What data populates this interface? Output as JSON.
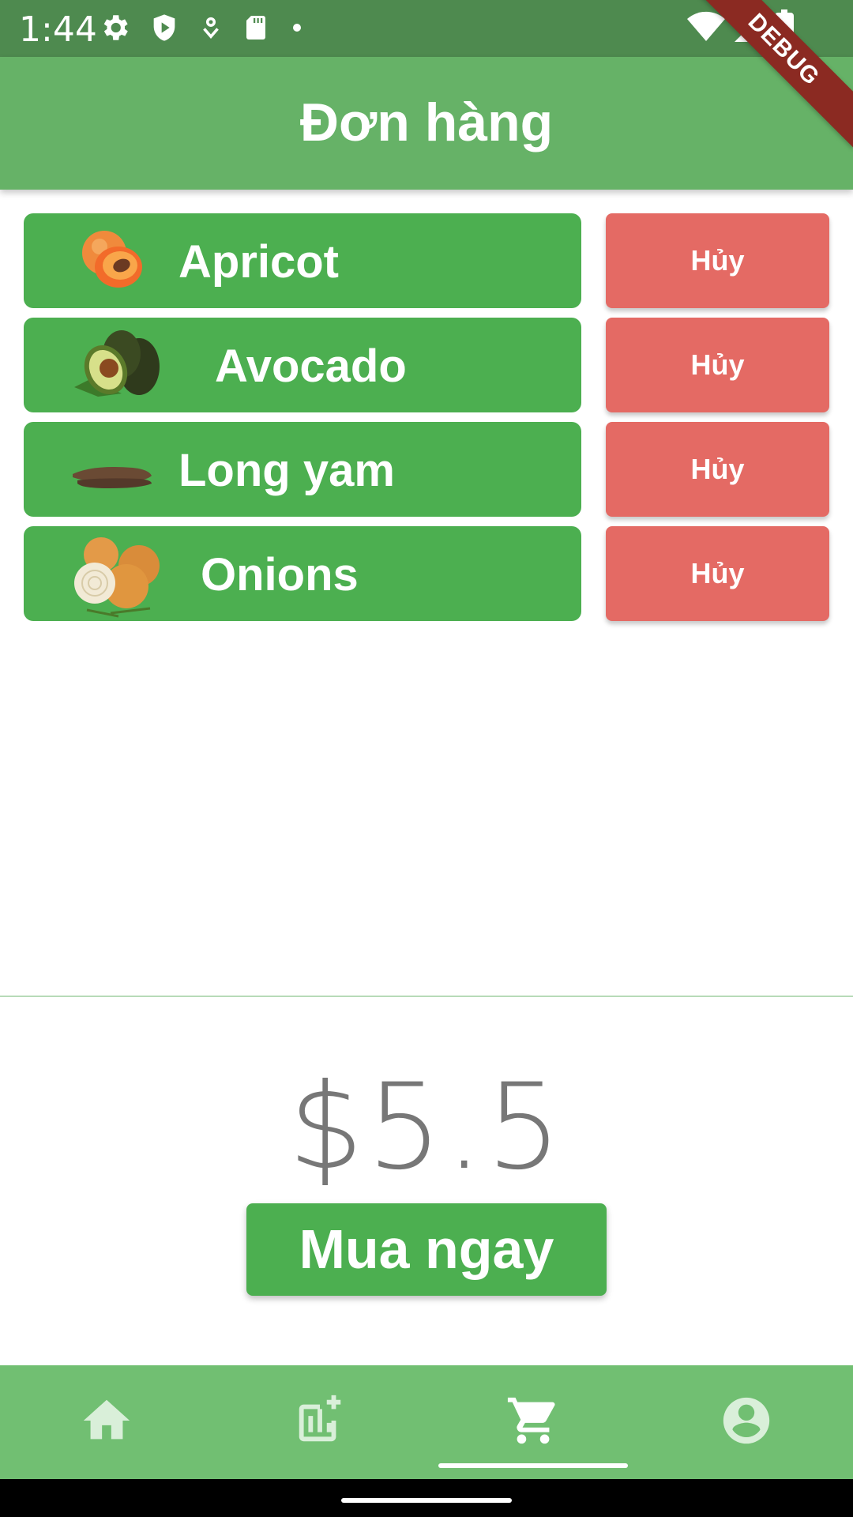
{
  "status_bar": {
    "time": "1:44"
  },
  "debug_banner": "DEBUG",
  "app_bar": {
    "title": "Đơn hàng"
  },
  "orders": [
    {
      "name": "Apricot",
      "image": "apricot-image",
      "cancel_label": "Hủy"
    },
    {
      "name": "Avocado",
      "image": "avocado-image",
      "cancel_label": "Hủy"
    },
    {
      "name": "Long yam",
      "image": "long-yam-image",
      "cancel_label": "Hủy"
    },
    {
      "name": "Onions",
      "image": "onions-image",
      "cancel_label": "Hủy"
    }
  ],
  "summary": {
    "total": "$5.5",
    "buy_label": "Mua ngay"
  },
  "bottom_nav": {
    "items": [
      {
        "icon": "home-icon",
        "selected": false
      },
      {
        "icon": "chart-add-icon",
        "selected": false
      },
      {
        "icon": "cart-icon",
        "selected": true
      },
      {
        "icon": "account-icon",
        "selected": false
      }
    ]
  },
  "colors": {
    "status_bar": "#4e8a4f",
    "app_bar": "#66b267",
    "item_card": "#4caf50",
    "cancel_button": "#e46a64",
    "buy_button": "#4caf50",
    "bottom_nav": "#71bf72",
    "bottom_nav_inactive_icon": "#d9efd9",
    "total_text": "#777777"
  }
}
